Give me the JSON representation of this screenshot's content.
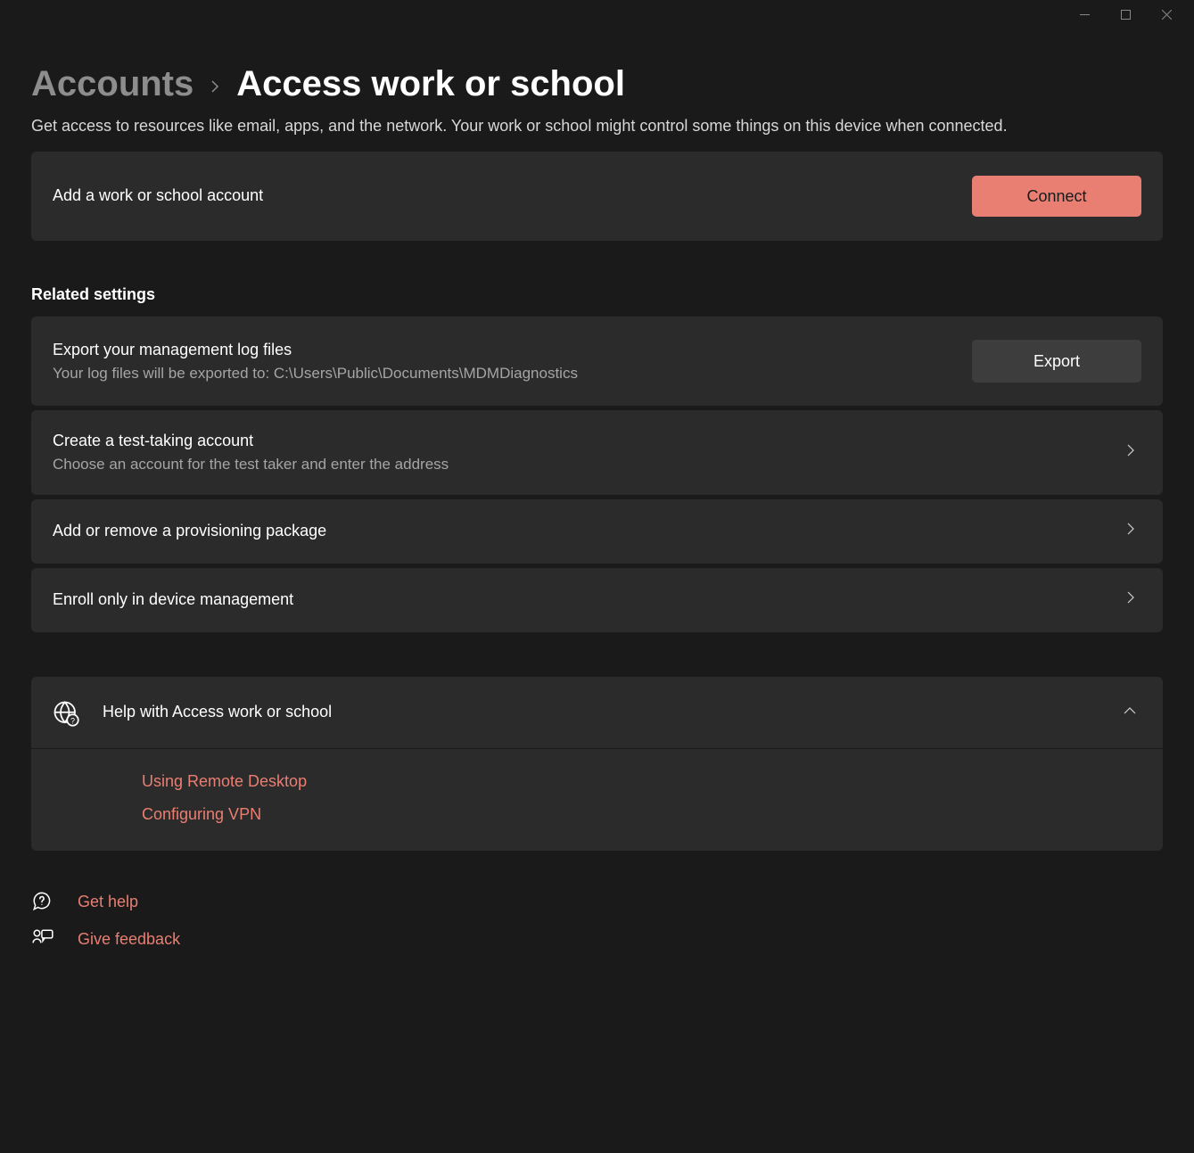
{
  "breadcrumb": {
    "parent": "Accounts",
    "current": "Access work or school"
  },
  "description": "Get access to resources like email, apps, and the network. Your work or school might control some things on this device when connected.",
  "addAccount": {
    "label": "Add a work or school account",
    "button": "Connect"
  },
  "relatedSettings": {
    "header": "Related settings",
    "items": [
      {
        "title": "Export your management log files",
        "subtitle": "Your log files will be exported to: C:\\Users\\Public\\Documents\\MDMDiagnostics",
        "button": "Export"
      },
      {
        "title": "Create a test-taking account",
        "subtitle": "Choose an account for the test taker and enter the address"
      },
      {
        "title": "Add or remove a provisioning package"
      },
      {
        "title": "Enroll only in device management"
      }
    ]
  },
  "help": {
    "title": "Help with Access work or school",
    "links": [
      "Using Remote Desktop",
      "Configuring VPN"
    ]
  },
  "footer": {
    "getHelp": "Get help",
    "giveFeedback": "Give feedback"
  }
}
